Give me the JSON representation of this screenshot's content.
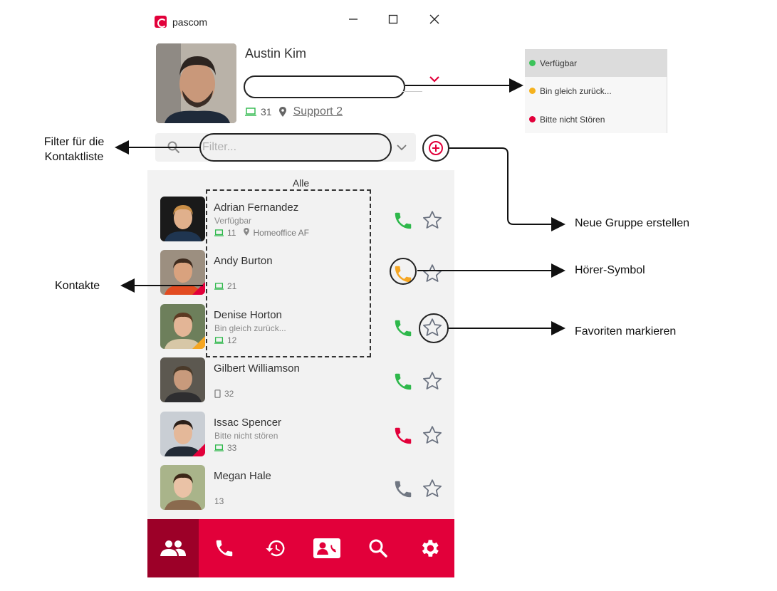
{
  "window": {
    "app_name": "pascom",
    "minimize_label": "—",
    "maximize_label": "☐",
    "close_label": "✕"
  },
  "user": {
    "name": "Austin Kim",
    "status_text": "",
    "extension": "31",
    "group": "Support 2"
  },
  "filter": {
    "placeholder": "Filter...",
    "value": ""
  },
  "contact_list": {
    "group_title": "Alle",
    "contacts": [
      {
        "name": "Adrian Fernandez",
        "status": "Verfügbar",
        "extension": "11",
        "location": "Homeoffice AF",
        "device": "desktop-icon",
        "phone_color": "#2eb84b",
        "presence_color": ""
      },
      {
        "name": "Andy Burton",
        "status": "",
        "extension": "21",
        "location": "",
        "device": "desktop-icon",
        "phone_color": "#f5a623",
        "presence_color": "#e2003a"
      },
      {
        "name": "Denise Horton",
        "status": "Bin gleich zurück...",
        "extension": "12",
        "location": "",
        "device": "desktop-icon",
        "phone_color": "#2eb84b",
        "presence_color": "#f5a623"
      },
      {
        "name": "Gilbert Williamson",
        "status": "",
        "extension": "32",
        "location": "",
        "device": "mobile-icon",
        "phone_color": "#2eb84b",
        "presence_color": ""
      },
      {
        "name": "Issac Spencer",
        "status": "Bitte nicht stören",
        "extension": "33",
        "location": "",
        "device": "desktop-icon",
        "phone_color": "#e2003a",
        "presence_color": "#e2003a"
      },
      {
        "name": "Megan Hale",
        "status": "",
        "extension": "13",
        "location": "",
        "device": "",
        "phone_color": "#707782",
        "presence_color": ""
      }
    ]
  },
  "bottom_nav": [
    "contacts-icon",
    "phone-icon",
    "history-icon",
    "address-book-icon",
    "search-icon",
    "settings-icon"
  ],
  "status_menu": {
    "options": [
      {
        "label": "Verfügbar",
        "color": "#3cc35a",
        "selected": true
      },
      {
        "label": "Bin gleich zurück...",
        "color": "#f5b21e",
        "selected": false
      },
      {
        "label": "Bitte nicht Stören",
        "color": "#e2003a",
        "selected": false
      }
    ]
  },
  "annotations": {
    "filter_line1": "Filter für die",
    "filter_line2": "Kontaktliste",
    "contacts": "Kontakte",
    "new_group": "Neue Gruppe erstellen",
    "handset": "Hörer-Symbol",
    "favorite": "Favoriten markieren"
  },
  "colors": {
    "brand": "#e2003a",
    "brand_dark": "#9c0028",
    "available": "#2eb84b",
    "away": "#f5a623"
  }
}
